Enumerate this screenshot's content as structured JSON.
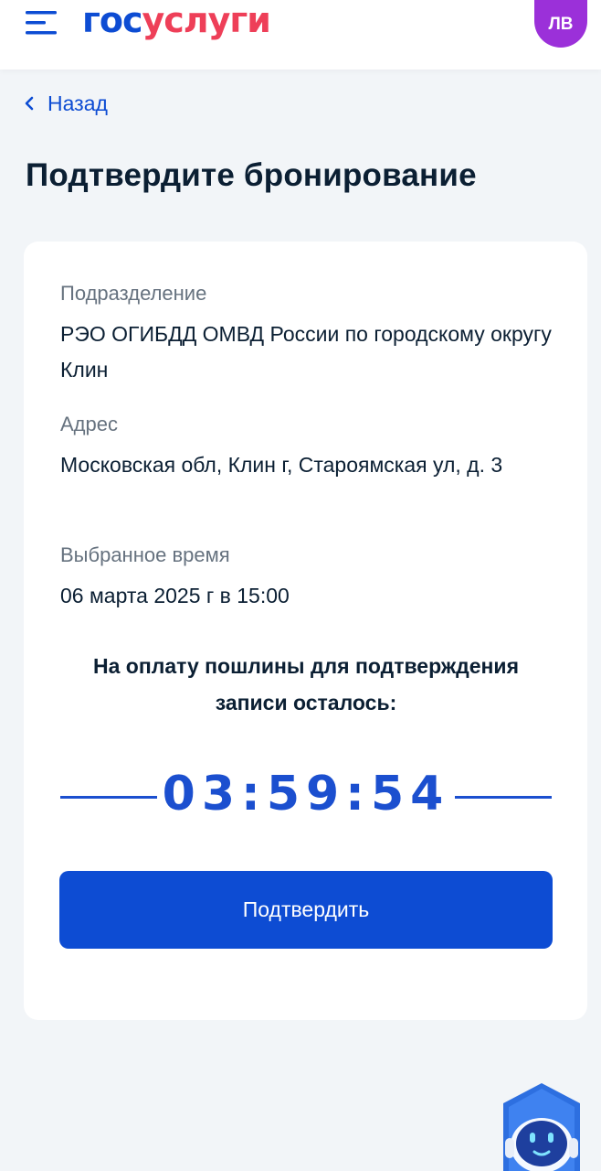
{
  "header": {
    "logo_part1": "гос",
    "logo_part2": "услуги",
    "avatar_initials": "ЛВ",
    "menu_icon": "hamburger-icon"
  },
  "nav": {
    "back_label": "Назад",
    "back_icon": "chevron-left-icon"
  },
  "page": {
    "title": "Подтвердите бронирование"
  },
  "booking": {
    "department_label": "Подразделение",
    "department_value": "РЭО ОГИБДД ОМВД России по городскому округу Клин",
    "address_label": "Адрес",
    "address_value": "Московская обл, Клин г, Староямская ул, д. 3",
    "time_label": "Выбранное время",
    "time_value": "06 марта 2025 г в 15:00"
  },
  "payment": {
    "notice": "На оплату пошлины для подтверждения записи осталось:",
    "timer": "03:59:54"
  },
  "actions": {
    "confirm_label": "Подтвердить"
  },
  "colors": {
    "brand_blue": "#0d4cd3",
    "brand_red": "#ee3f58",
    "avatar_purple": "#9b30d9",
    "timer_blue": "#1b4fcf"
  },
  "assistant_icon": "robot-assistant-icon"
}
